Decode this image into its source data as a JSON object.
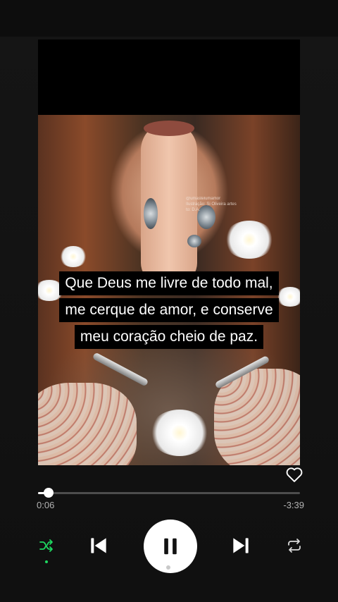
{
  "lyrics": {
    "lines": [
      "Que Deus me livre de todo mal,",
      "me cerque de amor, e conserve",
      "meu coração cheio de paz."
    ]
  },
  "artwork_watermark": {
    "lines": [
      "@umastelumamor",
      "Ilustração: Si Oliveira artes",
      "to: D.A."
    ]
  },
  "player": {
    "elapsed": "0:06",
    "remaining": "-3:39",
    "progress_fraction": 0.04,
    "liked": false,
    "is_playing": true,
    "shuffle_active": true
  },
  "icons": {
    "like": "heart-outline-icon",
    "shuffle": "shuffle-icon",
    "previous": "skip-previous-icon",
    "play_pause": "pause-icon",
    "next": "skip-next-icon",
    "repeat": "repeat-icon"
  },
  "colors": {
    "background": "#121212",
    "accent": "#1ed760",
    "secondary_text": "#b3b3b3"
  }
}
